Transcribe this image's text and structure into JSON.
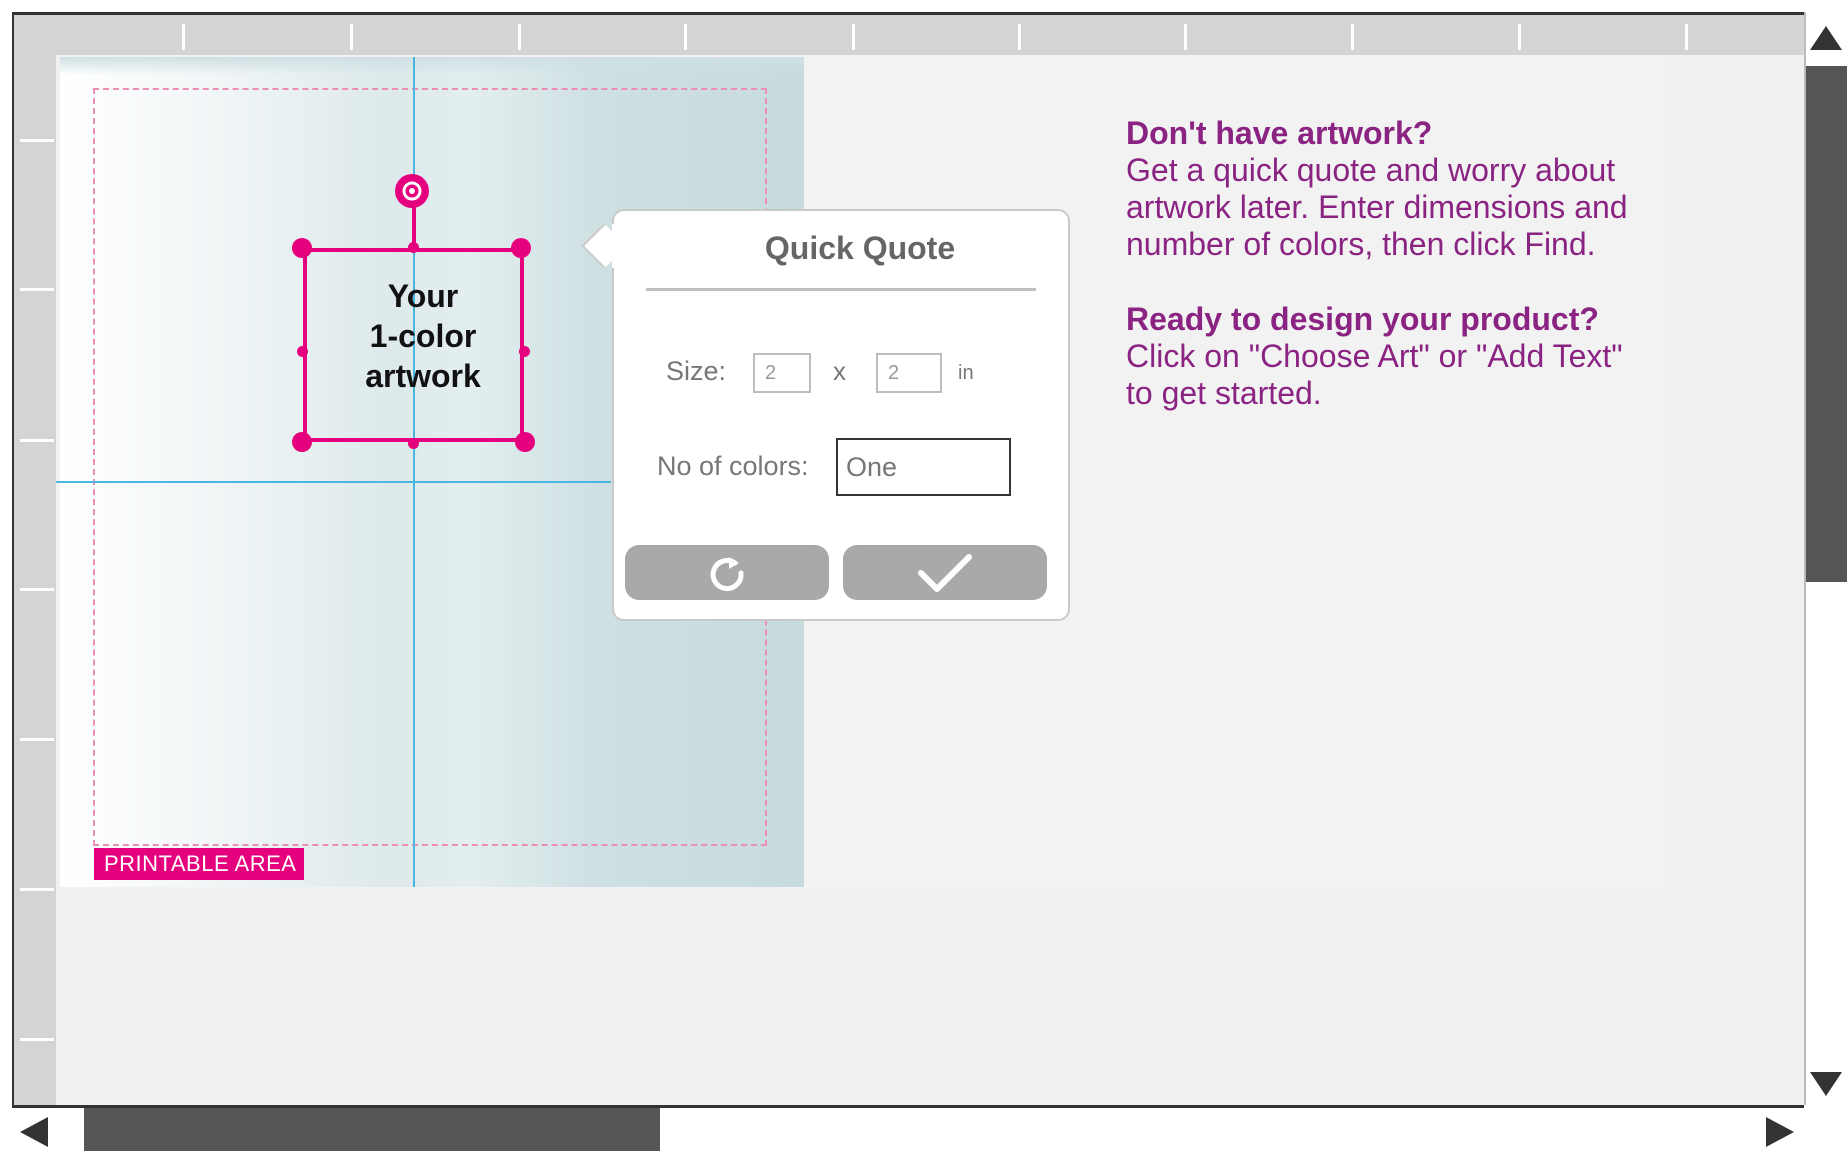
{
  "canvas": {
    "printable_label": "PRINTABLE AREA",
    "artwork_text": [
      "Your",
      "1-color",
      "artwork"
    ]
  },
  "quick_quote": {
    "title": "Quick Quote",
    "size_label": "Size:",
    "width_value": "2",
    "separator": "x",
    "height_value": "2",
    "unit": "in",
    "colors_label": "No of colors:",
    "colors_value": "One",
    "reset_icon": "refresh-icon",
    "confirm_icon": "check-icon"
  },
  "info_panel": {
    "heading1": "Don't have artwork?",
    "body1": "Get a quick quote and worry about artwork later. Enter dimensions and number of colors, then click Find.",
    "heading2": "Ready to design your product?",
    "body2": "Click on \"Choose Art\" or \"Add Text\" to get started."
  },
  "colors": {
    "accent": "#e5007d",
    "info_text": "#8a2382",
    "guide": "#4ab7de"
  }
}
